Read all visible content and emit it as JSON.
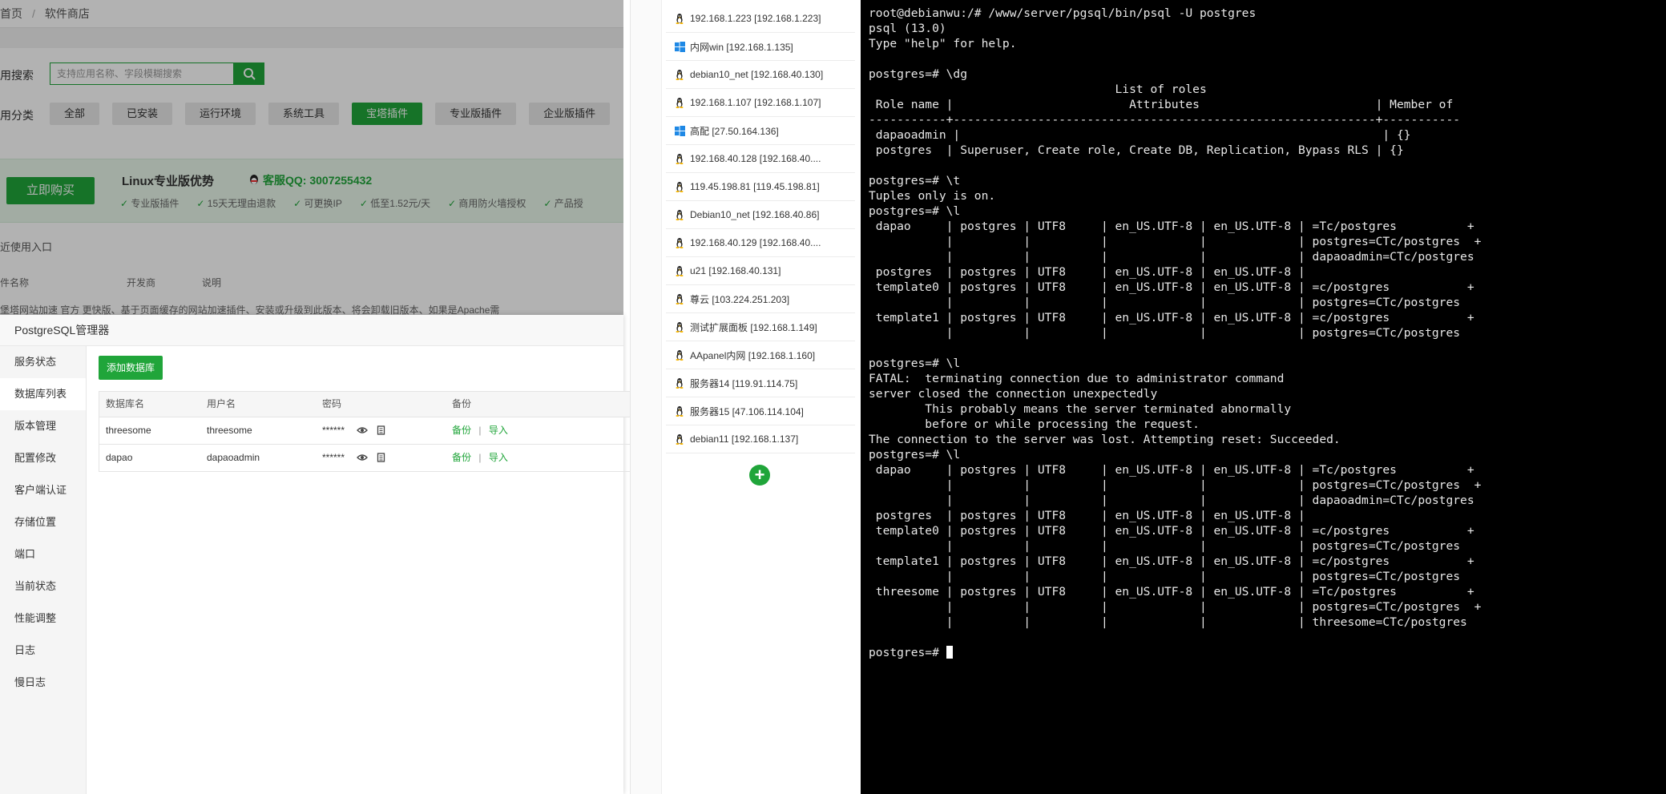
{
  "store": {
    "breadcrumb_home": "首页",
    "breadcrumb_sep": "/",
    "breadcrumb_current": "软件商店",
    "search_label": "用搜索",
    "search_placeholder": "支持应用名称、字段模糊搜索",
    "category_label": "用分类",
    "categories": [
      "全部",
      "已安装",
      "运行环境",
      "系统工具",
      "宝塔插件",
      "专业版插件",
      "企业版插件"
    ],
    "buy_button": "立即购买",
    "promo_title": "Linux专业版优势",
    "promo_qq": "客服QQ: 3007255432",
    "promo_features": [
      "专业版插件",
      "15天无理由退款",
      "可更换IP",
      "低至1.52元/天",
      "商用防火墙授权",
      "产品授"
    ],
    "recent_label": "近使用入口",
    "table_headers": [
      "件名称",
      "开发商",
      "说明"
    ],
    "table_row": "堡塔网站加速    官方    更快版、基于页面缓存的网站加速插件、安装或升级到此版本、将会卸载旧版本、如果是Apache需"
  },
  "pg_dialog": {
    "title": "PostgreSQL管理器",
    "menu": [
      "服务状态",
      "数据库列表",
      "版本管理",
      "配置修改",
      "客户端认证",
      "存储位置",
      "端口",
      "当前状态",
      "性能调整",
      "日志",
      "慢日志"
    ],
    "add_button": "添加数据库",
    "headers": [
      "数据库名",
      "用户名",
      "密码",
      "备份"
    ],
    "rows": [
      {
        "db": "threesome",
        "user": "threesome",
        "password": "******",
        "backup": "备份",
        "sep": "|",
        "import": "导入"
      },
      {
        "db": "dapao",
        "user": "dapaoadmin",
        "password": "******",
        "backup": "备份",
        "sep": "|",
        "import": "导入"
      }
    ]
  },
  "servers": [
    {
      "name": "192.168.1.223 [192.168.1.223]",
      "os": "linux"
    },
    {
      "name": "内网win [192.168.1.135]",
      "os": "windows"
    },
    {
      "name": "debian10_net [192.168.40.130]",
      "os": "linux"
    },
    {
      "name": "192.168.1.107 [192.168.1.107]",
      "os": "linux"
    },
    {
      "name": "高配 [27.50.164.136]",
      "os": "windows"
    },
    {
      "name": "192.168.40.128 [192.168.40....",
      "os": "linux"
    },
    {
      "name": "119.45.198.81 [119.45.198.81]",
      "os": "linux"
    },
    {
      "name": "Debian10_net [192.168.40.86]",
      "os": "linux"
    },
    {
      "name": "192.168.40.129 [192.168.40....",
      "os": "linux"
    },
    {
      "name": "u21 [192.168.40.131]",
      "os": "linux"
    },
    {
      "name": "尊云 [103.224.251.203]",
      "os": "linux"
    },
    {
      "name": "测试扩展面板 [192.168.1.149]",
      "os": "linux"
    },
    {
      "name": "AApanel内网 [192.168.1.160]",
      "os": "linux"
    },
    {
      "name": "服务器14 [119.91.114.75]",
      "os": "linux"
    },
    {
      "name": "服务器15 [47.106.114.104]",
      "os": "linux"
    },
    {
      "name": "debian11 [192.168.1.137]",
      "os": "linux"
    }
  ],
  "colors": {
    "accent": "#20a53a",
    "terminal_bg": "#000000",
    "terminal_fg": "#e8e8e8"
  },
  "terminal": {
    "prompt": "postgres=# ",
    "lines": [
      "root@debianwu:/# /www/server/pgsql/bin/psql -U postgres",
      "psql (13.0)",
      "Type \"help\" for help.",
      "",
      "postgres=# \\dg",
      "                                   List of roles",
      " Role name |                         Attributes                         | Member of",
      "-----------+------------------------------------------------------------+-----------",
      " dapaoadmin |                                                            | {}",
      " postgres  | Superuser, Create role, Create DB, Replication, Bypass RLS | {}",
      "",
      "postgres=# \\t",
      "Tuples only is on.",
      "postgres=# \\l",
      " dapao     | postgres | UTF8     | en_US.UTF-8 | en_US.UTF-8 | =Tc/postgres          +",
      "           |          |          |             |             | postgres=CTc/postgres  +",
      "           |          |          |             |             | dapaoadmin=CTc/postgres",
      " postgres  | postgres | UTF8     | en_US.UTF-8 | en_US.UTF-8 |",
      " template0 | postgres | UTF8     | en_US.UTF-8 | en_US.UTF-8 | =c/postgres           +",
      "           |          |          |             |             | postgres=CTc/postgres",
      " template1 | postgres | UTF8     | en_US.UTF-8 | en_US.UTF-8 | =c/postgres           +",
      "           |          |          |             |             | postgres=CTc/postgres",
      "",
      "postgres=# \\l",
      "FATAL:  terminating connection due to administrator command",
      "server closed the connection unexpectedly",
      "        This probably means the server terminated abnormally",
      "        before or while processing the request.",
      "The connection to the server was lost. Attempting reset: Succeeded.",
      "postgres=# \\l",
      " dapao     | postgres | UTF8     | en_US.UTF-8 | en_US.UTF-8 | =Tc/postgres          +",
      "           |          |          |             |             | postgres=CTc/postgres  +",
      "           |          |          |             |             | dapaoadmin=CTc/postgres",
      " postgres  | postgres | UTF8     | en_US.UTF-8 | en_US.UTF-8 |",
      " template0 | postgres | UTF8     | en_US.UTF-8 | en_US.UTF-8 | =c/postgres           +",
      "           |          |          |             |             | postgres=CTc/postgres",
      " template1 | postgres | UTF8     | en_US.UTF-8 | en_US.UTF-8 | =c/postgres           +",
      "           |          |          |             |             | postgres=CTc/postgres",
      " threesome | postgres | UTF8     | en_US.UTF-8 | en_US.UTF-8 | =Tc/postgres          +",
      "           |          |          |             |             | postgres=CTc/postgres  +",
      "           |          |          |             |             | threesome=CTc/postgres",
      ""
    ]
  }
}
